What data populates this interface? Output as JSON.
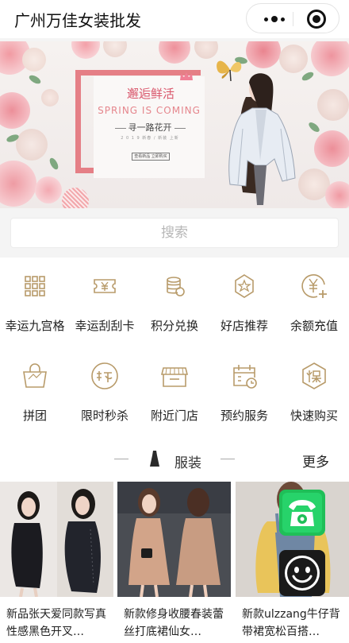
{
  "header": {
    "title": "广州万佳女装批发"
  },
  "banner": {
    "title": "邂逅鲜活",
    "english": "SPRING IS COMING",
    "subtitle": "寻一路花开",
    "small_text": "2 0 1 9 新春 / 新装 上新",
    "button_text": "查看新品  立即购买",
    "slides": 6,
    "active_slide": 1
  },
  "search": {
    "placeholder": "搜索"
  },
  "menu": [
    {
      "label": "幸运九宫格",
      "icon": "grid-icon"
    },
    {
      "label": "幸运刮刮卡",
      "icon": "ticket-icon"
    },
    {
      "label": "积分兑换",
      "icon": "coins-icon"
    },
    {
      "label": "好店推荐",
      "icon": "badge-star-icon"
    },
    {
      "label": "余额充值",
      "icon": "yen-plus-icon"
    },
    {
      "label": "拼团",
      "icon": "shopping-bag-icon"
    },
    {
      "label": "限时秒杀",
      "icon": "seckill-icon"
    },
    {
      "label": "附近门店",
      "icon": "storefront-icon"
    },
    {
      "label": "预约服务",
      "icon": "calendar-clock-icon"
    },
    {
      "label": "快速购买",
      "icon": "quick-buy-icon"
    }
  ],
  "section": {
    "title": "服装",
    "more": "更多"
  },
  "products": [
    {
      "name": "新品张天爱同款写真性感黑色开叉…"
    },
    {
      "name": "新款修身收腰春装蕾丝打底裙仙女…"
    },
    {
      "name": "新款ulzzang牛仔背带裙宽松百搭…"
    }
  ],
  "colors": {
    "icon_gold": "#b89b6a",
    "banner_pink": "#e57f86",
    "active_dot": "#1a1a1a"
  }
}
